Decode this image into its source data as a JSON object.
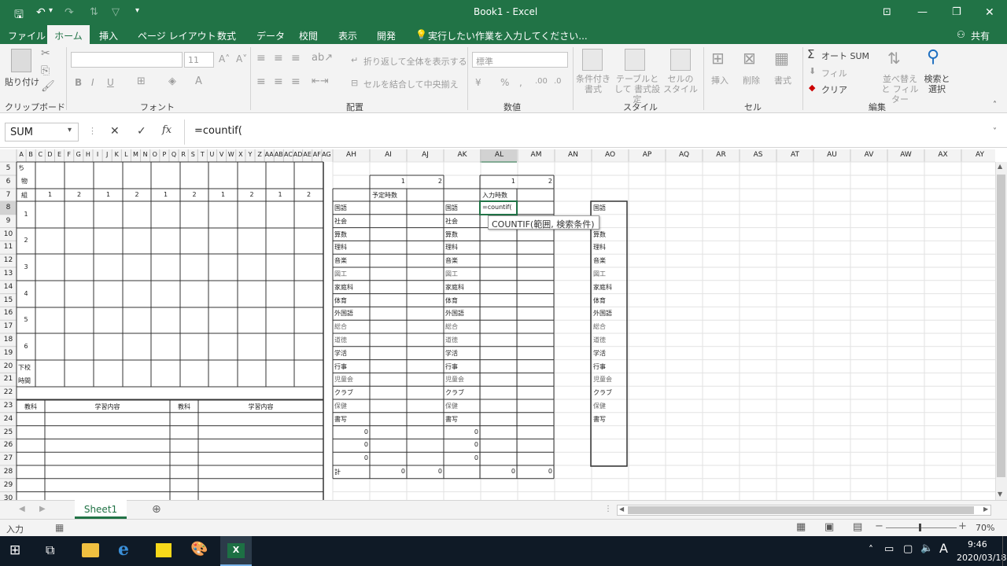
{
  "title": "Book1 - Excel",
  "tabs": [
    "ファイル",
    "ホーム",
    "挿入",
    "ページ レイアウト",
    "数式",
    "データ",
    "校閲",
    "表示",
    "開発"
  ],
  "tell_me": "実行したい作業を入力してください...",
  "share": "共有",
  "ribbon": {
    "clipboard": {
      "paste": "貼り付け",
      "group": "クリップボード"
    },
    "font": {
      "size": "11",
      "group": "フォント",
      "bold": "B",
      "italic": "I",
      "underline": "U"
    },
    "alignment": {
      "wrap": "折り返して全体を表示する",
      "merge": "セルを結合して中央揃え",
      "group": "配置"
    },
    "number": {
      "format": "標準",
      "group": "数値"
    },
    "styles": {
      "conditional": "条件付き 書式",
      "table": "テーブルとして 書式設定",
      "cell": "セルの スタイル",
      "group": "スタイル"
    },
    "cells": {
      "insert": "挿入",
      "delete": "削除",
      "format": "書式",
      "group": "セル"
    },
    "editing": {
      "autosum": "オート SUM",
      "fill": "フィル",
      "clear": "クリア",
      "sort": "並べ替えと フィルター",
      "find": "検索と 選択",
      "group": "編集"
    }
  },
  "namebox": "SUM",
  "fx": "fx",
  "formula": "=countif(",
  "tooltip": "COUNTIF(範囲, 検索条件)",
  "columns_left": [
    "A",
    "B",
    "C",
    "D",
    "E",
    "F",
    "G",
    "H",
    "I",
    "J",
    "K",
    "L",
    "M",
    "N",
    "O",
    "P",
    "Q",
    "R",
    "S",
    "T",
    "U",
    "V",
    "W",
    "X",
    "Y",
    "Z",
    "AA",
    "AB",
    "AC",
    "AD",
    "AE",
    "AF",
    "AG"
  ],
  "columns_right": [
    "AH",
    "AI",
    "AJ",
    "AK",
    "AL",
    "AM",
    "AN",
    "AO",
    "AP",
    "AQ",
    "AR",
    "AS",
    "AT",
    "AU",
    "AV",
    "AW",
    "AX",
    "AY"
  ],
  "rows": [
    "5",
    "6",
    "7",
    "8",
    "9",
    "10",
    "11",
    "12",
    "13",
    "14",
    "15",
    "16",
    "17",
    "18",
    "19",
    "20",
    "21",
    "22",
    "23",
    "24",
    "25",
    "26",
    "27",
    "28",
    "29",
    "30"
  ],
  "left_sheet": {
    "r5": "ち",
    "r6": "物",
    "r7_label": "組",
    "r7_nums": [
      "1",
      "2",
      "1",
      "2",
      "1",
      "2",
      "1",
      "2",
      "1",
      "2"
    ],
    "blocks": [
      "1",
      "2",
      "3",
      "4",
      "5",
      "6"
    ],
    "r20": "下校",
    "r21": "時間",
    "headers": [
      "教科",
      "学習内容",
      "教科",
      "学習内容"
    ]
  },
  "right_sheet": {
    "top_nums": [
      "1",
      "2",
      "1",
      "2"
    ],
    "label1": "予定時数",
    "label2": "入力時数",
    "subjects": [
      "国語",
      "社会",
      "算数",
      "理科",
      "音楽",
      "図工",
      "家庭科",
      "体育",
      "外国語",
      "総合",
      "道徳",
      "学活",
      "行事",
      "児童会",
      "クラブ",
      "保健",
      "書写"
    ],
    "zeros": [
      "0",
      "0",
      "0"
    ],
    "total_label": "計",
    "totals": [
      "0",
      "0",
      "0",
      "0"
    ],
    "edit_cell": "=countif("
  },
  "sheet_tab": "Sheet1",
  "status": {
    "mode": "入力",
    "zoom": "70%"
  },
  "taskbar": {
    "time": "9:46",
    "date": "2020/03/18",
    "ime": "A"
  }
}
